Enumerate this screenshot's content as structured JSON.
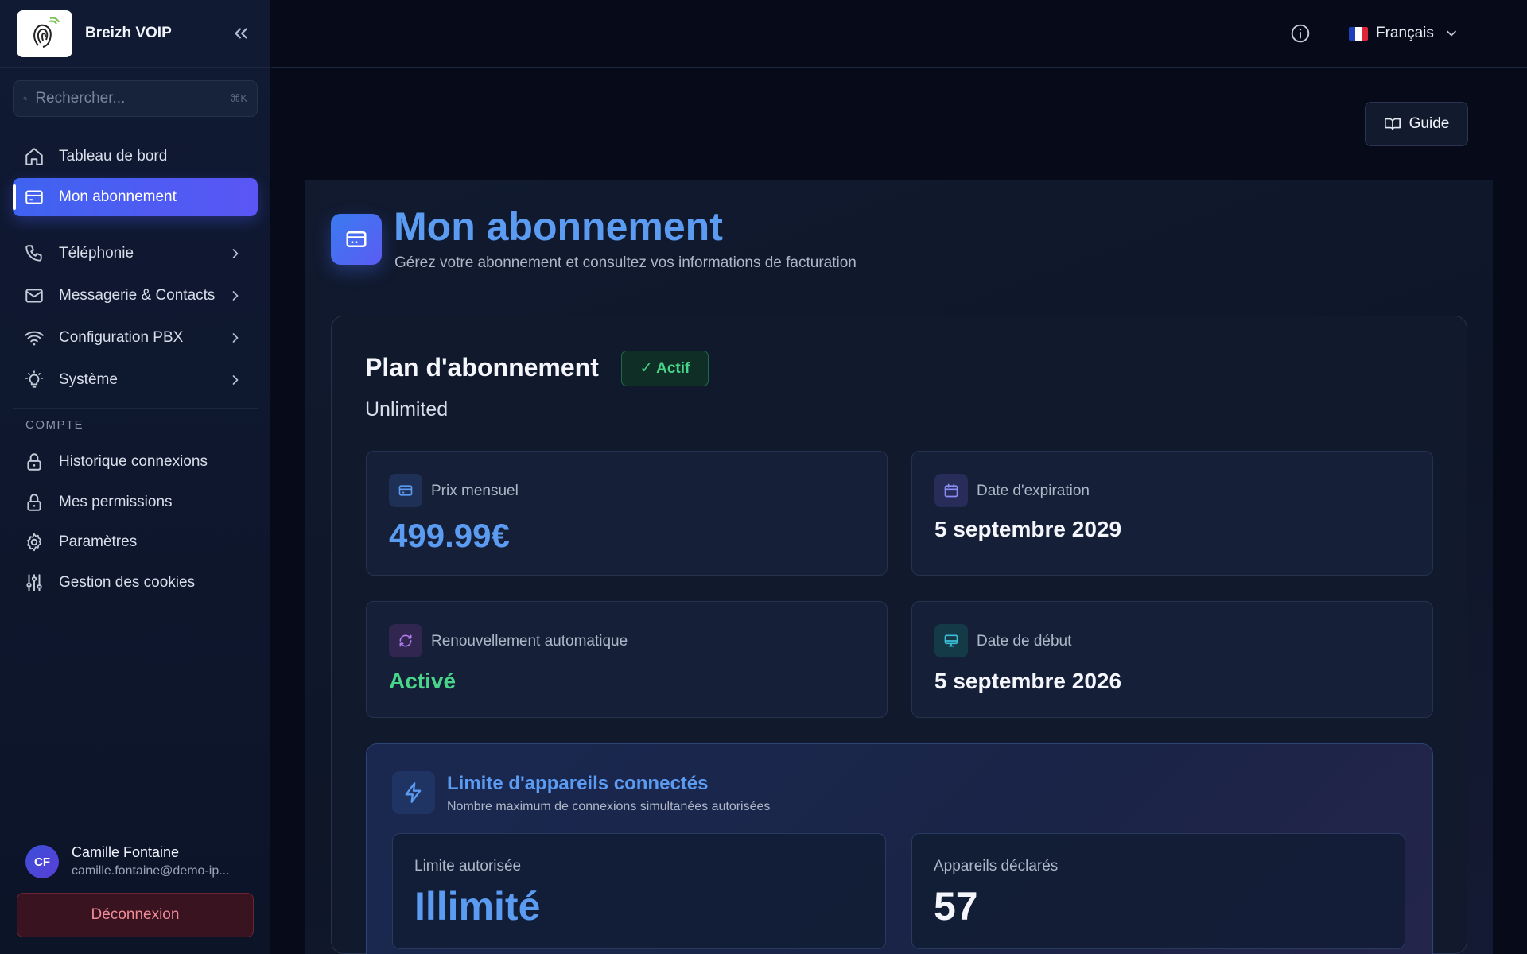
{
  "app": {
    "name": "Breizh VOIP"
  },
  "sidebar": {
    "search_placeholder": "Rechercher...",
    "search_shortcut": "⌘K",
    "items": [
      {
        "label": "Tableau de bord",
        "icon": "home-icon"
      },
      {
        "label": "Mon abonnement",
        "icon": "credit-card-icon",
        "active": true
      },
      {
        "label": "Téléphonie",
        "icon": "phone-icon"
      },
      {
        "label": "Messagerie & Contacts",
        "icon": "mail-icon"
      },
      {
        "label": "Configuration PBX",
        "icon": "wifi-icon"
      },
      {
        "label": "Système",
        "icon": "lightbulb-icon"
      }
    ],
    "section_label": "COMPTE",
    "account_items": [
      {
        "label": "Historique connexions",
        "icon": "lock-icon"
      },
      {
        "label": "Mes permissions",
        "icon": "lock-icon"
      },
      {
        "label": "Paramètres",
        "icon": "gear-icon"
      },
      {
        "label": "Gestion des cookies",
        "icon": "sliders-icon"
      }
    ],
    "user": {
      "initials": "CF",
      "name": "Camille Fontaine",
      "email": "camille.fontaine@demo-ip..."
    },
    "logout_label": "Déconnexion"
  },
  "topbar": {
    "language": "Français"
  },
  "guide_label": "Guide",
  "page": {
    "title": "Mon abonnement",
    "subtitle": "Gérez votre abonnement et consultez vos informations de facturation"
  },
  "plan": {
    "title": "Plan d'abonnement",
    "status": "✓ Actif",
    "name": "Unlimited",
    "stats": {
      "price": {
        "label": "Prix mensuel",
        "value": "499.99€"
      },
      "expiration": {
        "label": "Date d'expiration",
        "value": "5 septembre 2029"
      },
      "renewal": {
        "label": "Renouvellement automatique",
        "value": "Activé"
      },
      "start": {
        "label": "Date de début",
        "value": "5 septembre 2026"
      }
    }
  },
  "device_limit": {
    "title": "Limite d'appareils connectés",
    "subtitle": "Nombre maximum de connexions simultanées autorisées",
    "allowed": {
      "label": "Limite autorisée",
      "value": "Illimité"
    },
    "declared": {
      "label": "Appareils déclarés",
      "value": "57"
    }
  },
  "colors": {
    "accent": "#5b9cf2",
    "active_nav": "#4f5ef2",
    "success": "#48d489",
    "danger": "#f08b97",
    "background": "#070b19"
  }
}
